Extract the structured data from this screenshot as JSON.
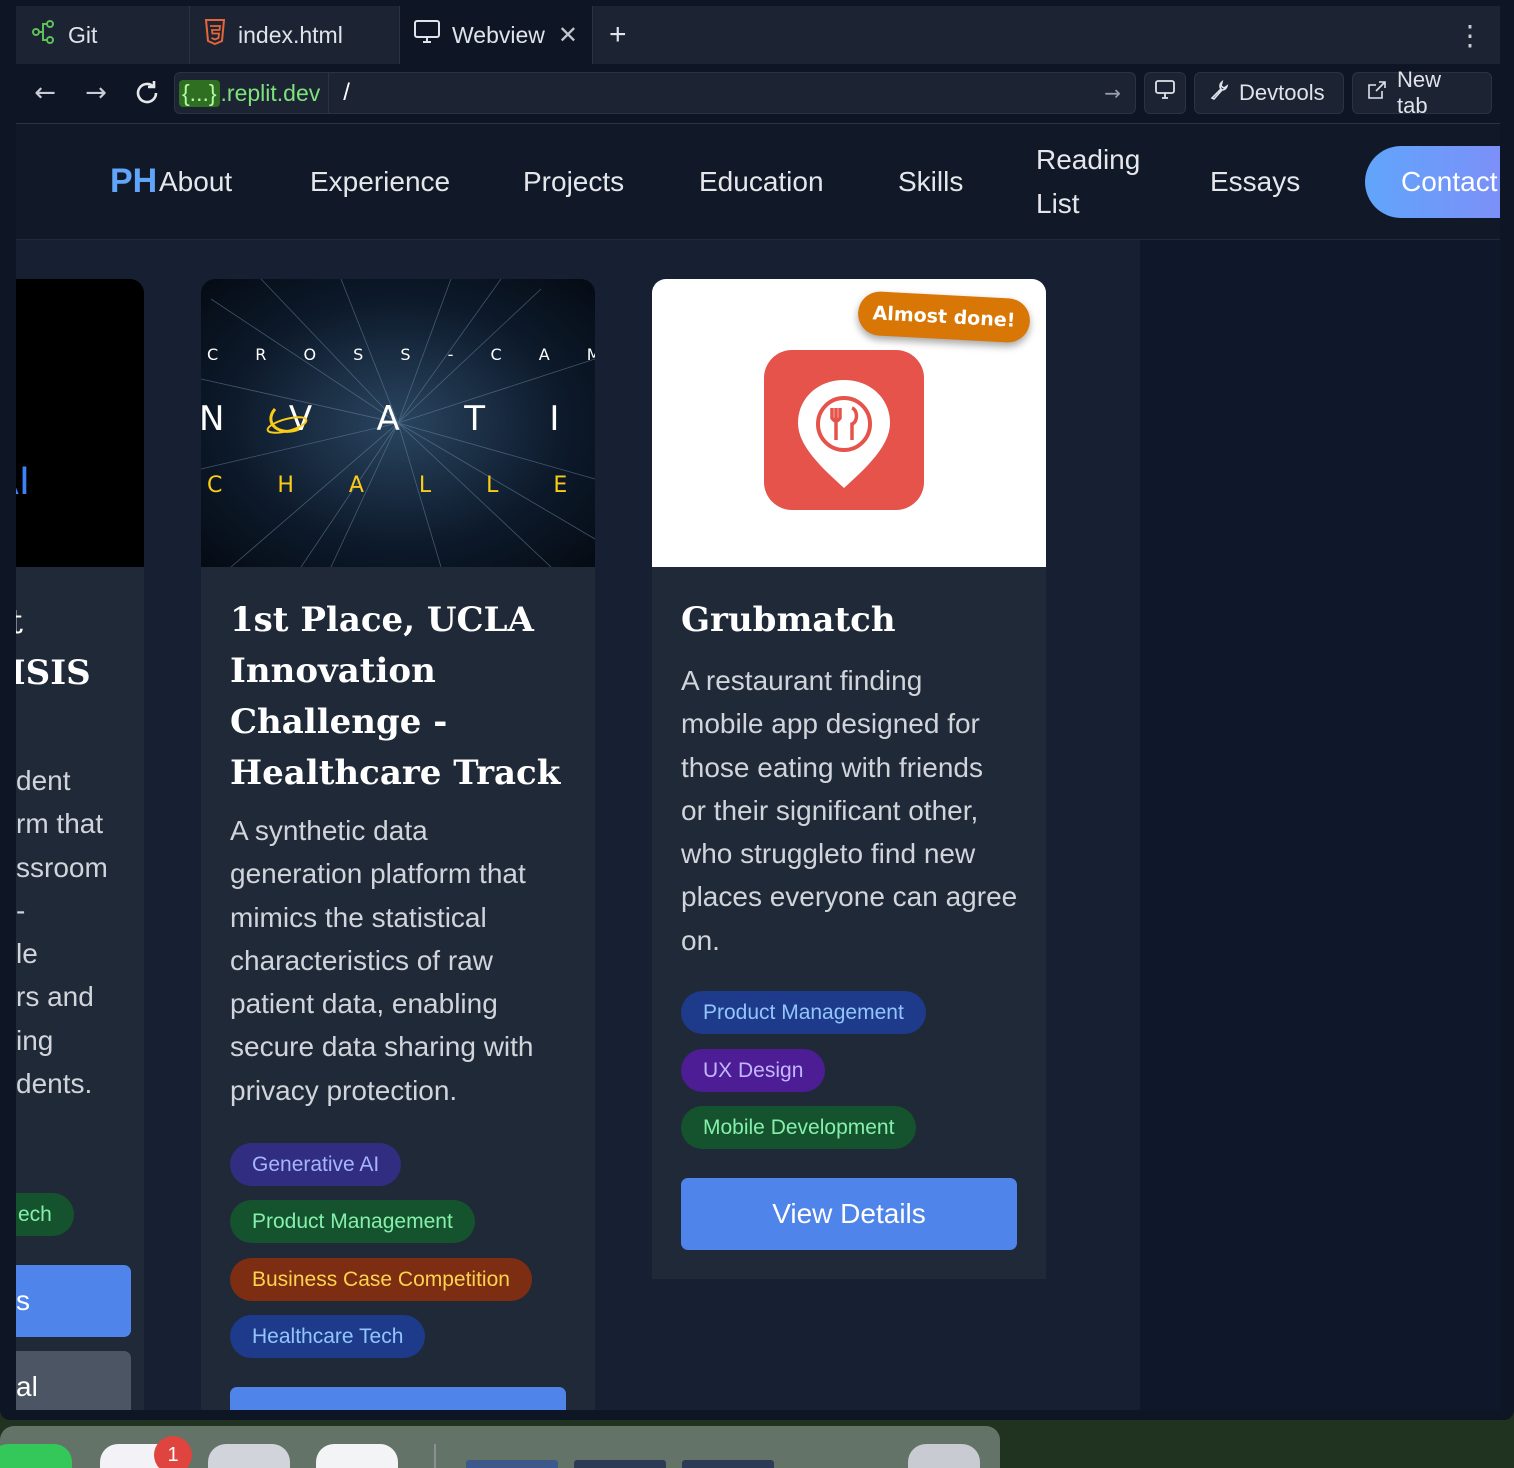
{
  "tabs": [
    {
      "label": "Git",
      "icon": "git-branch-icon"
    },
    {
      "label": "index.html",
      "icon": "html5-icon"
    },
    {
      "label": "Webview",
      "icon": "monitor-icon",
      "active": true
    }
  ],
  "urlbar": {
    "host_brace": "{...}",
    "host_domain": ".replit.dev",
    "path": "/",
    "devtools_label": "Devtools",
    "newtab_label": "New tab"
  },
  "site": {
    "logo": "PH",
    "nav": [
      "About",
      "Experience",
      "Projects",
      "Education",
      "Skills",
      "Reading",
      "List",
      "Essays"
    ],
    "contact_label": "Contact"
  },
  "cards": {
    "left": {
      "image_text": "ɅI",
      "title_lines": [
        "st",
        "MSIS"
      ],
      "desc_lines": [
        "dent",
        "rm that",
        "ssroom",
        "-",
        "le",
        "rs and",
        "ing",
        "dents."
      ],
      "tag": "ech",
      "button1": "s",
      "button2": "al"
    },
    "middle": {
      "image_line1": "C R O S S - C A M P U S",
      "image_line2": "N   V   A   T   I",
      "image_line3": "C H A L L E N G E",
      "title": "1st Place, UCLA Innovation Challenge - Healthcare Track",
      "title_lines": [
        "1st Place, UCLA",
        "Innovation",
        "Challenge -",
        "Healthcare Track"
      ],
      "desc_lines": [
        "A synthetic data",
        "generation platform that",
        "mimics the statistical",
        "characteristics of raw",
        "patient data, enabling",
        "secure data sharing with",
        "privacy protection."
      ],
      "tags": [
        "Generative AI",
        "Product Management",
        "Business Case Competition",
        "Healthcare Tech"
      ]
    },
    "right": {
      "badge": "Almost done!",
      "title": "Grubmatch",
      "desc_lines": [
        "A restaurant finding",
        "mobile app designed for",
        "those eating with friends",
        "or their significant other,",
        "who struggleto find new",
        "places everyone can agree",
        "on."
      ],
      "tags": [
        "Product Management",
        "UX Design",
        "Mobile Development"
      ],
      "button": "View Details"
    }
  },
  "dock": {
    "notification_count": "1"
  },
  "colors": {
    "accent_blue": "#4f84ea",
    "badge_orange": "#d97706",
    "app_icon_red": "#e5534b"
  }
}
